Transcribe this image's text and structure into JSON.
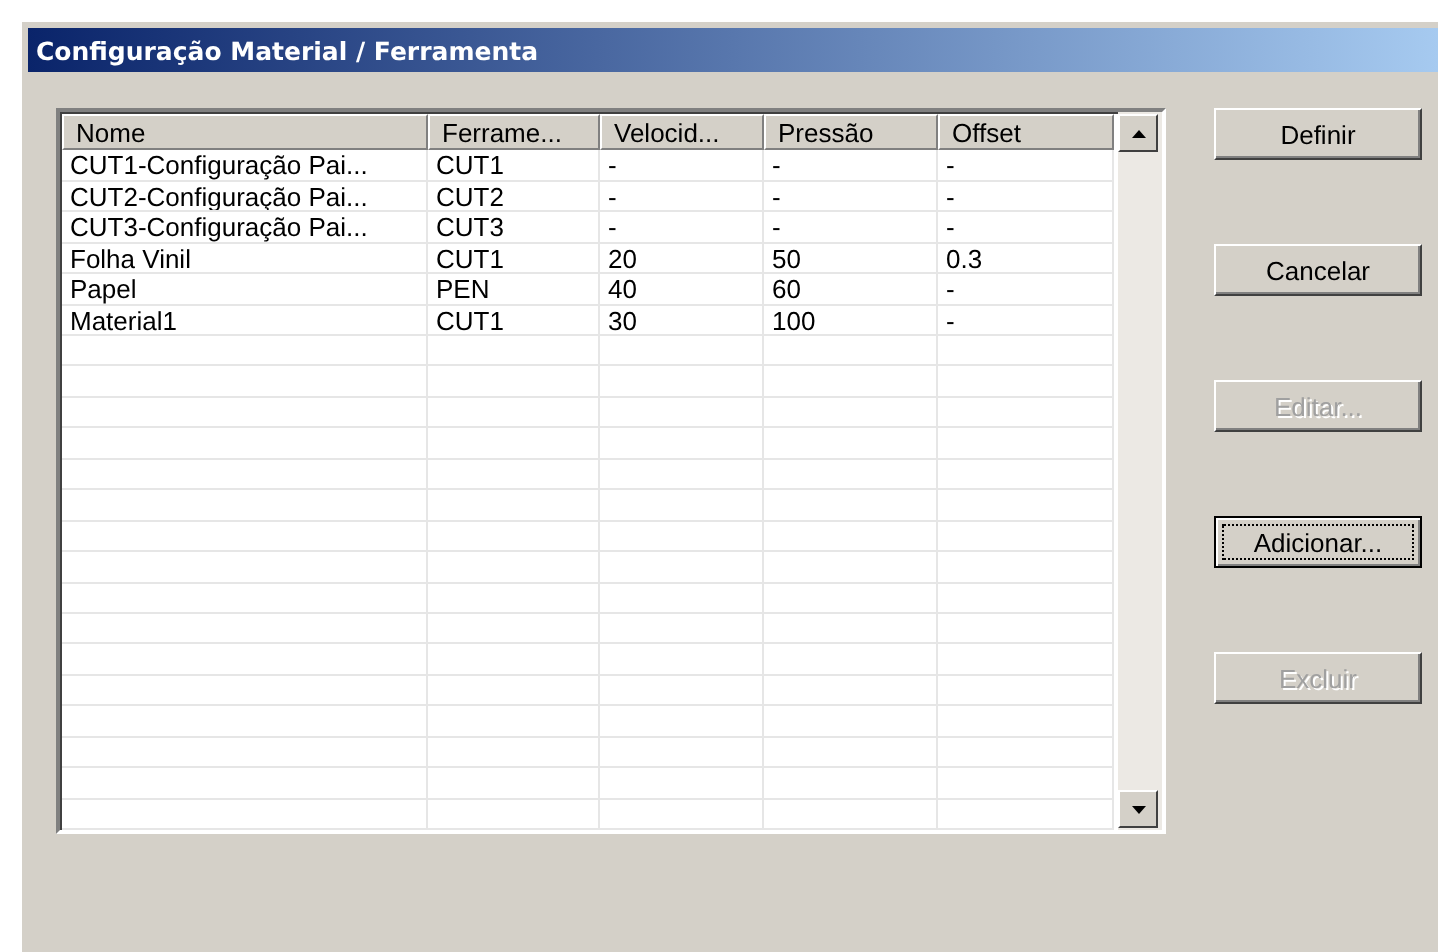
{
  "window": {
    "title": "Configuração Material / Ferramenta"
  },
  "table": {
    "columns": [
      "Nome",
      "Ferrame...",
      "Velocid...",
      "Pressão",
      "Offset"
    ],
    "rows": [
      [
        "CUT1-Configuração Pai...",
        "CUT1",
        "-",
        "-",
        "-"
      ],
      [
        "CUT2-Configuração Pai...",
        "CUT2",
        "-",
        "-",
        "-"
      ],
      [
        "CUT3-Configuração Pai...",
        "CUT3",
        "-",
        "-",
        "-"
      ],
      [
        "Folha Vinil",
        "CUT1",
        "20",
        "50",
        "0.3"
      ],
      [
        "Papel",
        "PEN",
        "40",
        "60",
        "-"
      ],
      [
        "Material1",
        "CUT1",
        "30",
        "100",
        "-"
      ]
    ]
  },
  "buttons": [
    {
      "label": "Definir",
      "disabled": false,
      "focused": false
    },
    {
      "label": "Cancelar",
      "disabled": false,
      "focused": false
    },
    {
      "label": "Editar...",
      "disabled": true,
      "focused": false
    },
    {
      "label": "Adicionar...",
      "disabled": false,
      "focused": true
    },
    {
      "label": "Excluir",
      "disabled": true,
      "focused": false
    }
  ]
}
